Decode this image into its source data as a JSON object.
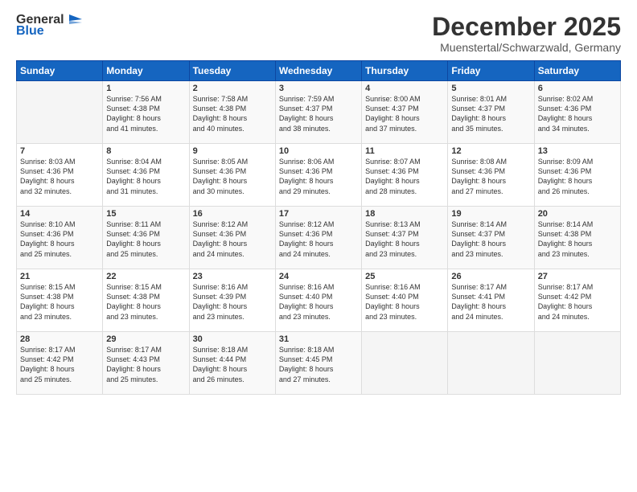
{
  "logo": {
    "line1": "General",
    "line2": "Blue"
  },
  "title": "December 2025",
  "subtitle": "Muenstertal/Schwarzwald, Germany",
  "days_of_week": [
    "Sunday",
    "Monday",
    "Tuesday",
    "Wednesday",
    "Thursday",
    "Friday",
    "Saturday"
  ],
  "weeks": [
    [
      {
        "day": "",
        "content": ""
      },
      {
        "day": "1",
        "content": "Sunrise: 7:56 AM\nSunset: 4:38 PM\nDaylight: 8 hours\nand 41 minutes."
      },
      {
        "day": "2",
        "content": "Sunrise: 7:58 AM\nSunset: 4:38 PM\nDaylight: 8 hours\nand 40 minutes."
      },
      {
        "day": "3",
        "content": "Sunrise: 7:59 AM\nSunset: 4:37 PM\nDaylight: 8 hours\nand 38 minutes."
      },
      {
        "day": "4",
        "content": "Sunrise: 8:00 AM\nSunset: 4:37 PM\nDaylight: 8 hours\nand 37 minutes."
      },
      {
        "day": "5",
        "content": "Sunrise: 8:01 AM\nSunset: 4:37 PM\nDaylight: 8 hours\nand 35 minutes."
      },
      {
        "day": "6",
        "content": "Sunrise: 8:02 AM\nSunset: 4:36 PM\nDaylight: 8 hours\nand 34 minutes."
      }
    ],
    [
      {
        "day": "7",
        "content": "Sunrise: 8:03 AM\nSunset: 4:36 PM\nDaylight: 8 hours\nand 32 minutes."
      },
      {
        "day": "8",
        "content": "Sunrise: 8:04 AM\nSunset: 4:36 PM\nDaylight: 8 hours\nand 31 minutes."
      },
      {
        "day": "9",
        "content": "Sunrise: 8:05 AM\nSunset: 4:36 PM\nDaylight: 8 hours\nand 30 minutes."
      },
      {
        "day": "10",
        "content": "Sunrise: 8:06 AM\nSunset: 4:36 PM\nDaylight: 8 hours\nand 29 minutes."
      },
      {
        "day": "11",
        "content": "Sunrise: 8:07 AM\nSunset: 4:36 PM\nDaylight: 8 hours\nand 28 minutes."
      },
      {
        "day": "12",
        "content": "Sunrise: 8:08 AM\nSunset: 4:36 PM\nDaylight: 8 hours\nand 27 minutes."
      },
      {
        "day": "13",
        "content": "Sunrise: 8:09 AM\nSunset: 4:36 PM\nDaylight: 8 hours\nand 26 minutes."
      }
    ],
    [
      {
        "day": "14",
        "content": "Sunrise: 8:10 AM\nSunset: 4:36 PM\nDaylight: 8 hours\nand 25 minutes."
      },
      {
        "day": "15",
        "content": "Sunrise: 8:11 AM\nSunset: 4:36 PM\nDaylight: 8 hours\nand 25 minutes."
      },
      {
        "day": "16",
        "content": "Sunrise: 8:12 AM\nSunset: 4:36 PM\nDaylight: 8 hours\nand 24 minutes."
      },
      {
        "day": "17",
        "content": "Sunrise: 8:12 AM\nSunset: 4:36 PM\nDaylight: 8 hours\nand 24 minutes."
      },
      {
        "day": "18",
        "content": "Sunrise: 8:13 AM\nSunset: 4:37 PM\nDaylight: 8 hours\nand 23 minutes."
      },
      {
        "day": "19",
        "content": "Sunrise: 8:14 AM\nSunset: 4:37 PM\nDaylight: 8 hours\nand 23 minutes."
      },
      {
        "day": "20",
        "content": "Sunrise: 8:14 AM\nSunset: 4:38 PM\nDaylight: 8 hours\nand 23 minutes."
      }
    ],
    [
      {
        "day": "21",
        "content": "Sunrise: 8:15 AM\nSunset: 4:38 PM\nDaylight: 8 hours\nand 23 minutes."
      },
      {
        "day": "22",
        "content": "Sunrise: 8:15 AM\nSunset: 4:38 PM\nDaylight: 8 hours\nand 23 minutes."
      },
      {
        "day": "23",
        "content": "Sunrise: 8:16 AM\nSunset: 4:39 PM\nDaylight: 8 hours\nand 23 minutes."
      },
      {
        "day": "24",
        "content": "Sunrise: 8:16 AM\nSunset: 4:40 PM\nDaylight: 8 hours\nand 23 minutes."
      },
      {
        "day": "25",
        "content": "Sunrise: 8:16 AM\nSunset: 4:40 PM\nDaylight: 8 hours\nand 23 minutes."
      },
      {
        "day": "26",
        "content": "Sunrise: 8:17 AM\nSunset: 4:41 PM\nDaylight: 8 hours\nand 24 minutes."
      },
      {
        "day": "27",
        "content": "Sunrise: 8:17 AM\nSunset: 4:42 PM\nDaylight: 8 hours\nand 24 minutes."
      }
    ],
    [
      {
        "day": "28",
        "content": "Sunrise: 8:17 AM\nSunset: 4:42 PM\nDaylight: 8 hours\nand 25 minutes."
      },
      {
        "day": "29",
        "content": "Sunrise: 8:17 AM\nSunset: 4:43 PM\nDaylight: 8 hours\nand 25 minutes."
      },
      {
        "day": "30",
        "content": "Sunrise: 8:18 AM\nSunset: 4:44 PM\nDaylight: 8 hours\nand 26 minutes."
      },
      {
        "day": "31",
        "content": "Sunrise: 8:18 AM\nSunset: 4:45 PM\nDaylight: 8 hours\nand 27 minutes."
      },
      {
        "day": "",
        "content": ""
      },
      {
        "day": "",
        "content": ""
      },
      {
        "day": "",
        "content": ""
      }
    ]
  ]
}
